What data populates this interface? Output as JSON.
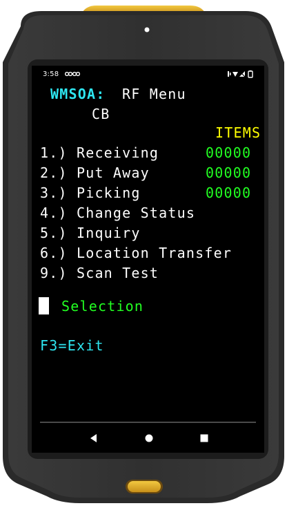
{
  "status_bar": {
    "time": "3:58",
    "icons": [
      "voicemail-icon",
      "voicemail-icon",
      "vibrate-icon",
      "wifi-icon",
      "no-signal-icon",
      "battery-icon"
    ]
  },
  "terminal": {
    "program": "WMSOA:",
    "title": "RF Menu",
    "subtitle": "CB",
    "items_header": "ITEMS",
    "menu": [
      {
        "label": "1.) Receiving",
        "count": "00000"
      },
      {
        "label": "2.) Put Away",
        "count": "00000"
      },
      {
        "label": "3.) Picking",
        "count": "00000"
      },
      {
        "label": "4.) Change Status",
        "count": ""
      },
      {
        "label": "5.) Inquiry",
        "count": ""
      },
      {
        "label": "6.) Location Transfer",
        "count": ""
      },
      {
        "label": "9.) Scan Test",
        "count": ""
      }
    ],
    "selection_label": "Selection",
    "selection_value": "",
    "exit_key": "F3=Exit"
  },
  "nav_bar": {
    "back_icon": "back-triangle-icon",
    "home_icon": "home-circle-icon",
    "recents_icon": "recents-square-icon"
  },
  "colors": {
    "cyan": "#2ee6f0",
    "yellow": "#ffff00",
    "green": "#22ff22",
    "white": "#ffffff",
    "device_body": "#2f2f2f",
    "accent_gold": "#e0b020"
  }
}
